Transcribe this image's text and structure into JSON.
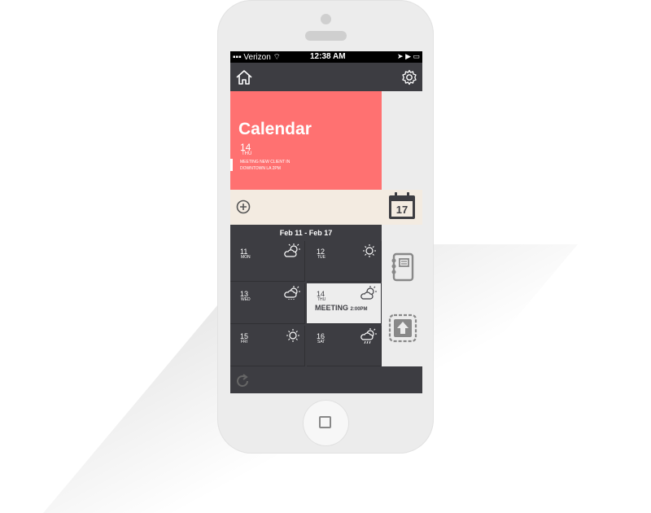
{
  "status": {
    "carrier": "Verizon",
    "time": "12:38 AM",
    "right": "➤ ▶ ▭"
  },
  "card": {
    "title": "Calendar",
    "day_number": "14",
    "day_name": "THU",
    "event_line1": "MEETING NEW CLIENT IN",
    "event_line2": "DOWNTOWN LA 2PM"
  },
  "calendar_badge": "17",
  "week": {
    "range": "Feb 11 - Feb 17",
    "days": [
      {
        "num": "11",
        "name": "MON",
        "weather": "cloud-sun"
      },
      {
        "num": "12",
        "name": "TUE",
        "weather": "sun"
      },
      {
        "num": "13",
        "name": "WED",
        "weather": "cloud-sun"
      },
      {
        "num": "14",
        "name": "THU",
        "weather": "cloud-sun",
        "event": "MEETING",
        "event_time": "2:00PM"
      },
      {
        "num": "15",
        "name": "FRI",
        "weather": "sun"
      },
      {
        "num": "16",
        "name": "SAT",
        "weather": "cloud-rain"
      }
    ]
  },
  "colors": {
    "accent": "#ff7171",
    "dark": "#3d3d42",
    "cream": "#f3ebe1",
    "light": "#ececec"
  }
}
